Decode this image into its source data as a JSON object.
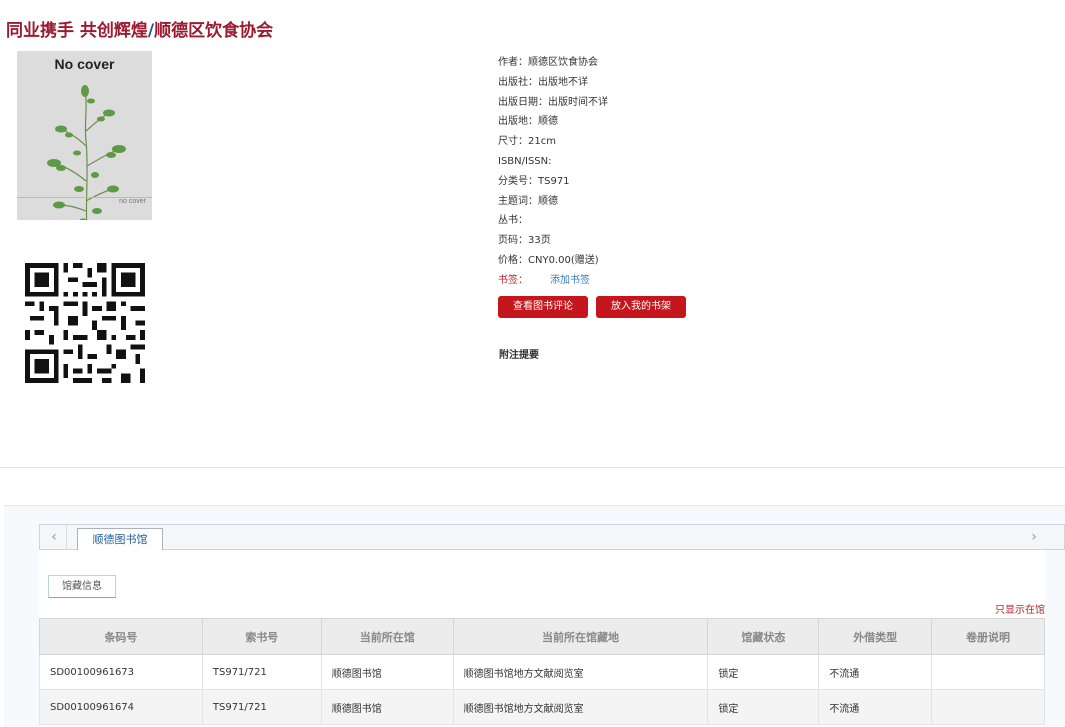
{
  "title": {
    "part1": "同业携手 共创辉煌",
    "sep": "/",
    "part2": "顺德区饮食协会"
  },
  "cover": {
    "title": "No cover",
    "footer": "no cover"
  },
  "meta": [
    {
      "label": "作者：",
      "value": "顺德区饮食协会"
    },
    {
      "label": "出版社：",
      "value": "出版地不详"
    },
    {
      "label": "出版日期：",
      "value": "出版时间不详"
    },
    {
      "label": "出版地：",
      "value": "顺德"
    },
    {
      "label": "尺寸：",
      "value": "21cm"
    },
    {
      "label": "ISBN/ISSN:",
      "value": ""
    },
    {
      "label": "分类号：",
      "value": "TS971"
    },
    {
      "label": "主题词：",
      "value": "顺德"
    },
    {
      "label": "丛书：",
      "value": ""
    },
    {
      "label": "页码：",
      "value": "33页"
    },
    {
      "label": "价格：",
      "value": "CNY0.00(赠送)"
    }
  ],
  "bookmark": {
    "label": "书签：",
    "link": "添加书签"
  },
  "buttons": {
    "reviews": "查看图书评论",
    "shelf": "放入我的书架"
  },
  "note_label": "附注提要",
  "tabs": {
    "prev": "‹",
    "next": "›",
    "active": "顺德图书馆"
  },
  "subtab": "馆藏信息",
  "only_show": "只显示在馆",
  "table": {
    "headers": [
      "条码号",
      "索书号",
      "当前所在馆",
      "当前所在馆藏地",
      "馆藏状态",
      "外借类型",
      "卷册说明"
    ],
    "rows": [
      [
        "SD00100961673",
        "TS971/721",
        "顺德图书馆",
        "顺德图书馆地方文献阅览室",
        "锁定",
        "不流通",
        ""
      ],
      [
        "SD00100961674",
        "TS971/721",
        "顺德图书馆",
        "顺德图书馆地方文献阅览室",
        "锁定",
        "不流通",
        ""
      ]
    ]
  }
}
